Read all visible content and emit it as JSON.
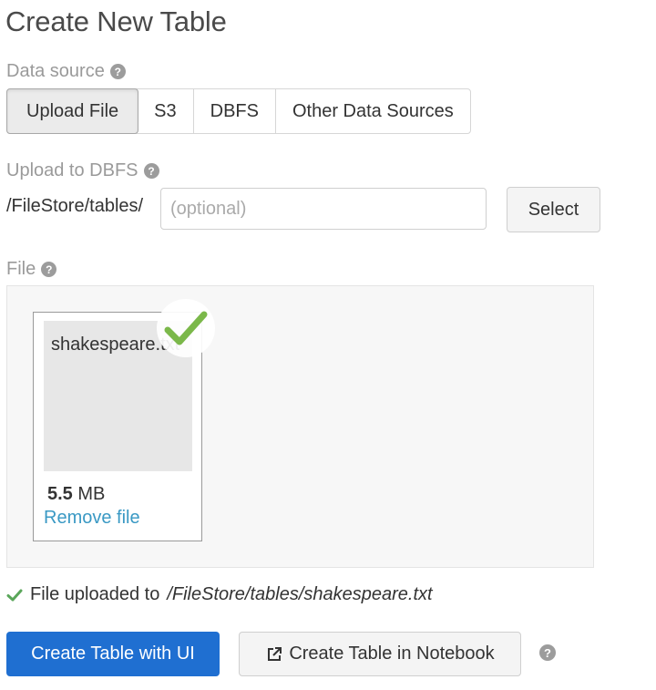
{
  "page": {
    "title": "Create New Table"
  },
  "data_source": {
    "label": "Data source",
    "tabs": [
      {
        "label": "Upload File",
        "active": true
      },
      {
        "label": "S3",
        "active": false
      },
      {
        "label": "DBFS",
        "active": false
      },
      {
        "label": "Other Data Sources",
        "active": false
      }
    ]
  },
  "upload_to_dbfs": {
    "label": "Upload to DBFS",
    "path_prefix": "/FileStore/tables/",
    "input_placeholder": "(optional)",
    "input_value": "",
    "select_label": "Select"
  },
  "file": {
    "label": "File",
    "name": "shakespeare.txt",
    "size_value": "5.5",
    "size_unit": "MB",
    "remove_label": "Remove file"
  },
  "status": {
    "prefix": "File uploaded to",
    "path": "/FileStore/tables/shakespeare.txt"
  },
  "actions": {
    "create_ui_label": "Create Table with UI",
    "create_notebook_label": "Create Table in Notebook"
  },
  "icons": {
    "help": "question-circle-icon",
    "check": "check-icon",
    "external": "external-link-icon"
  },
  "colors": {
    "primary": "#1f6fd1",
    "link": "#3a99c4",
    "success": "#7bb84a"
  }
}
